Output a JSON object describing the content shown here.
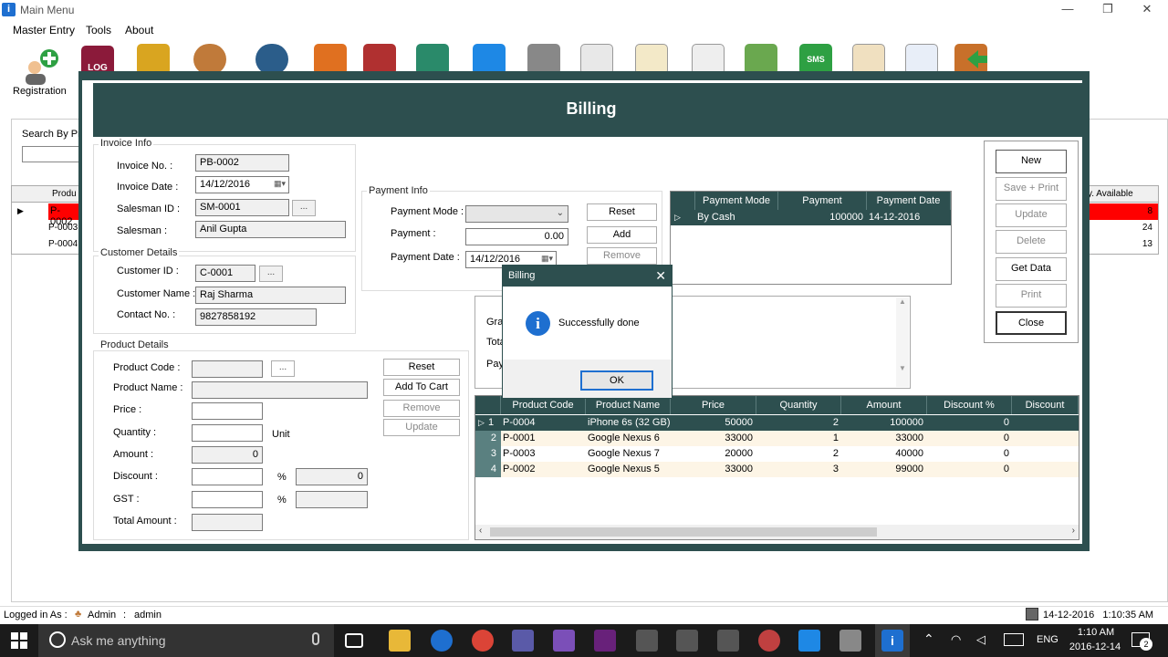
{
  "window": {
    "title": "Main Menu",
    "minimize": "—",
    "maximize": "❐",
    "close": "✕"
  },
  "menu": {
    "items": [
      "Master Entry",
      "Tools",
      "About"
    ]
  },
  "toolbar": {
    "registration_label": "Registration",
    "log_label": "LOG",
    "sms_label": "SMS"
  },
  "background": {
    "search_label": "Search By Pro",
    "grid_header": "Produ",
    "grid_rows": [
      "P-0002",
      "P-0003",
      "P-0004"
    ],
    "right_header": "y. Available",
    "right_rows": [
      "8",
      "24",
      "13"
    ]
  },
  "billing": {
    "title": "Billing",
    "invoice_info": {
      "label": "Invoice Info",
      "invoice_no_label": "Invoice No. :",
      "invoice_no": "PB-0002",
      "invoice_date_label": "Invoice Date :",
      "invoice_date": "14/12/2016",
      "salesman_id_label": "Salesman ID :",
      "salesman_id": "SM-0001",
      "salesman_label": "Salesman :",
      "salesman": "Anil Gupta",
      "browse": "..."
    },
    "customer_details": {
      "label": "Customer Details",
      "customer_id_label": "Customer ID :",
      "customer_id": "C-0001",
      "customer_name_label": "Customer Name :",
      "customer_name": "Raj Sharma",
      "contact_label": "Contact No. :",
      "contact": "9827858192",
      "browse": "..."
    },
    "payment_info": {
      "label": "Payment Info",
      "mode_label": "Payment Mode :",
      "mode_value": "",
      "payment_label": "Payment :",
      "payment_value": "0.00",
      "date_label": "Payment Date :",
      "date_value": "14/12/2016",
      "reset": "Reset",
      "add": "Add",
      "remove": "Remove"
    },
    "payment_grid": {
      "columns": [
        "Payment Mode",
        "Payment",
        "Payment Date"
      ],
      "rows": [
        {
          "mode": "By Cash",
          "payment": "100000",
          "date": "14-12-2016"
        }
      ]
    },
    "actions": {
      "new": "New",
      "save_print": "Save + Print",
      "update": "Update",
      "delete": "Delete",
      "get_data": "Get Data",
      "print": "Print",
      "close": "Close"
    },
    "product_details": {
      "label": "Product Details",
      "code_label": "Product Code :",
      "name_label": "Product Name :",
      "price_label": "Price :",
      "quantity_label": "Quantity :",
      "unit_label": "Unit",
      "amount_label": "Amount :",
      "amount_value": "0",
      "discount_label": "Discount :",
      "discount_pct": "%",
      "discount_value": "0",
      "gst_label": "GST :",
      "gst_pct": "%",
      "total_label": "Total Amount :",
      "browse": "...",
      "reset": "Reset",
      "add_to_cart": "Add To Cart",
      "remove": "Remove",
      "update": "Update"
    },
    "totals_partial": {
      "grand": "Gran",
      "total": "Tota",
      "pay": "Pay"
    },
    "cart_grid": {
      "columns": [
        "Product Code",
        "Product Name",
        "Price",
        "Quantity",
        "Amount",
        "Discount %",
        "Discount"
      ],
      "rows": [
        {
          "no": "1",
          "code": "P-0004",
          "name": "iPhone 6s (32 GB)",
          "price": "50000",
          "qty": "2",
          "amount": "100000",
          "disc_pct": "0"
        },
        {
          "no": "2",
          "code": "P-0001",
          "name": "Google Nexus 6",
          "price": "33000",
          "qty": "1",
          "amount": "33000",
          "disc_pct": "0"
        },
        {
          "no": "3",
          "code": "P-0003",
          "name": "Google Nexus 7",
          "price": "20000",
          "qty": "2",
          "amount": "40000",
          "disc_pct": "0"
        },
        {
          "no": "4",
          "code": "P-0002",
          "name": "Google Nexus 5",
          "price": "33000",
          "qty": "3",
          "amount": "99000",
          "disc_pct": "0"
        }
      ]
    }
  },
  "dialog": {
    "title": "Billing",
    "message": "Successfully done",
    "ok": "OK",
    "info_glyph": "i"
  },
  "statusbar": {
    "logged_in_as": "Logged in As :",
    "role": "Admin",
    "separator": ":",
    "user": "admin",
    "datetime": "14-12-2016   1:10:35 AM"
  },
  "taskbar": {
    "search_placeholder": "Ask me anything",
    "time": "1:10 AM",
    "date": "2016-12-14",
    "lang": "ENG",
    "notif_count": "2"
  },
  "colors": {
    "accent": "#2d4f4f",
    "selected_row": "#ff0000",
    "alt_row": "#fdf5e6"
  }
}
